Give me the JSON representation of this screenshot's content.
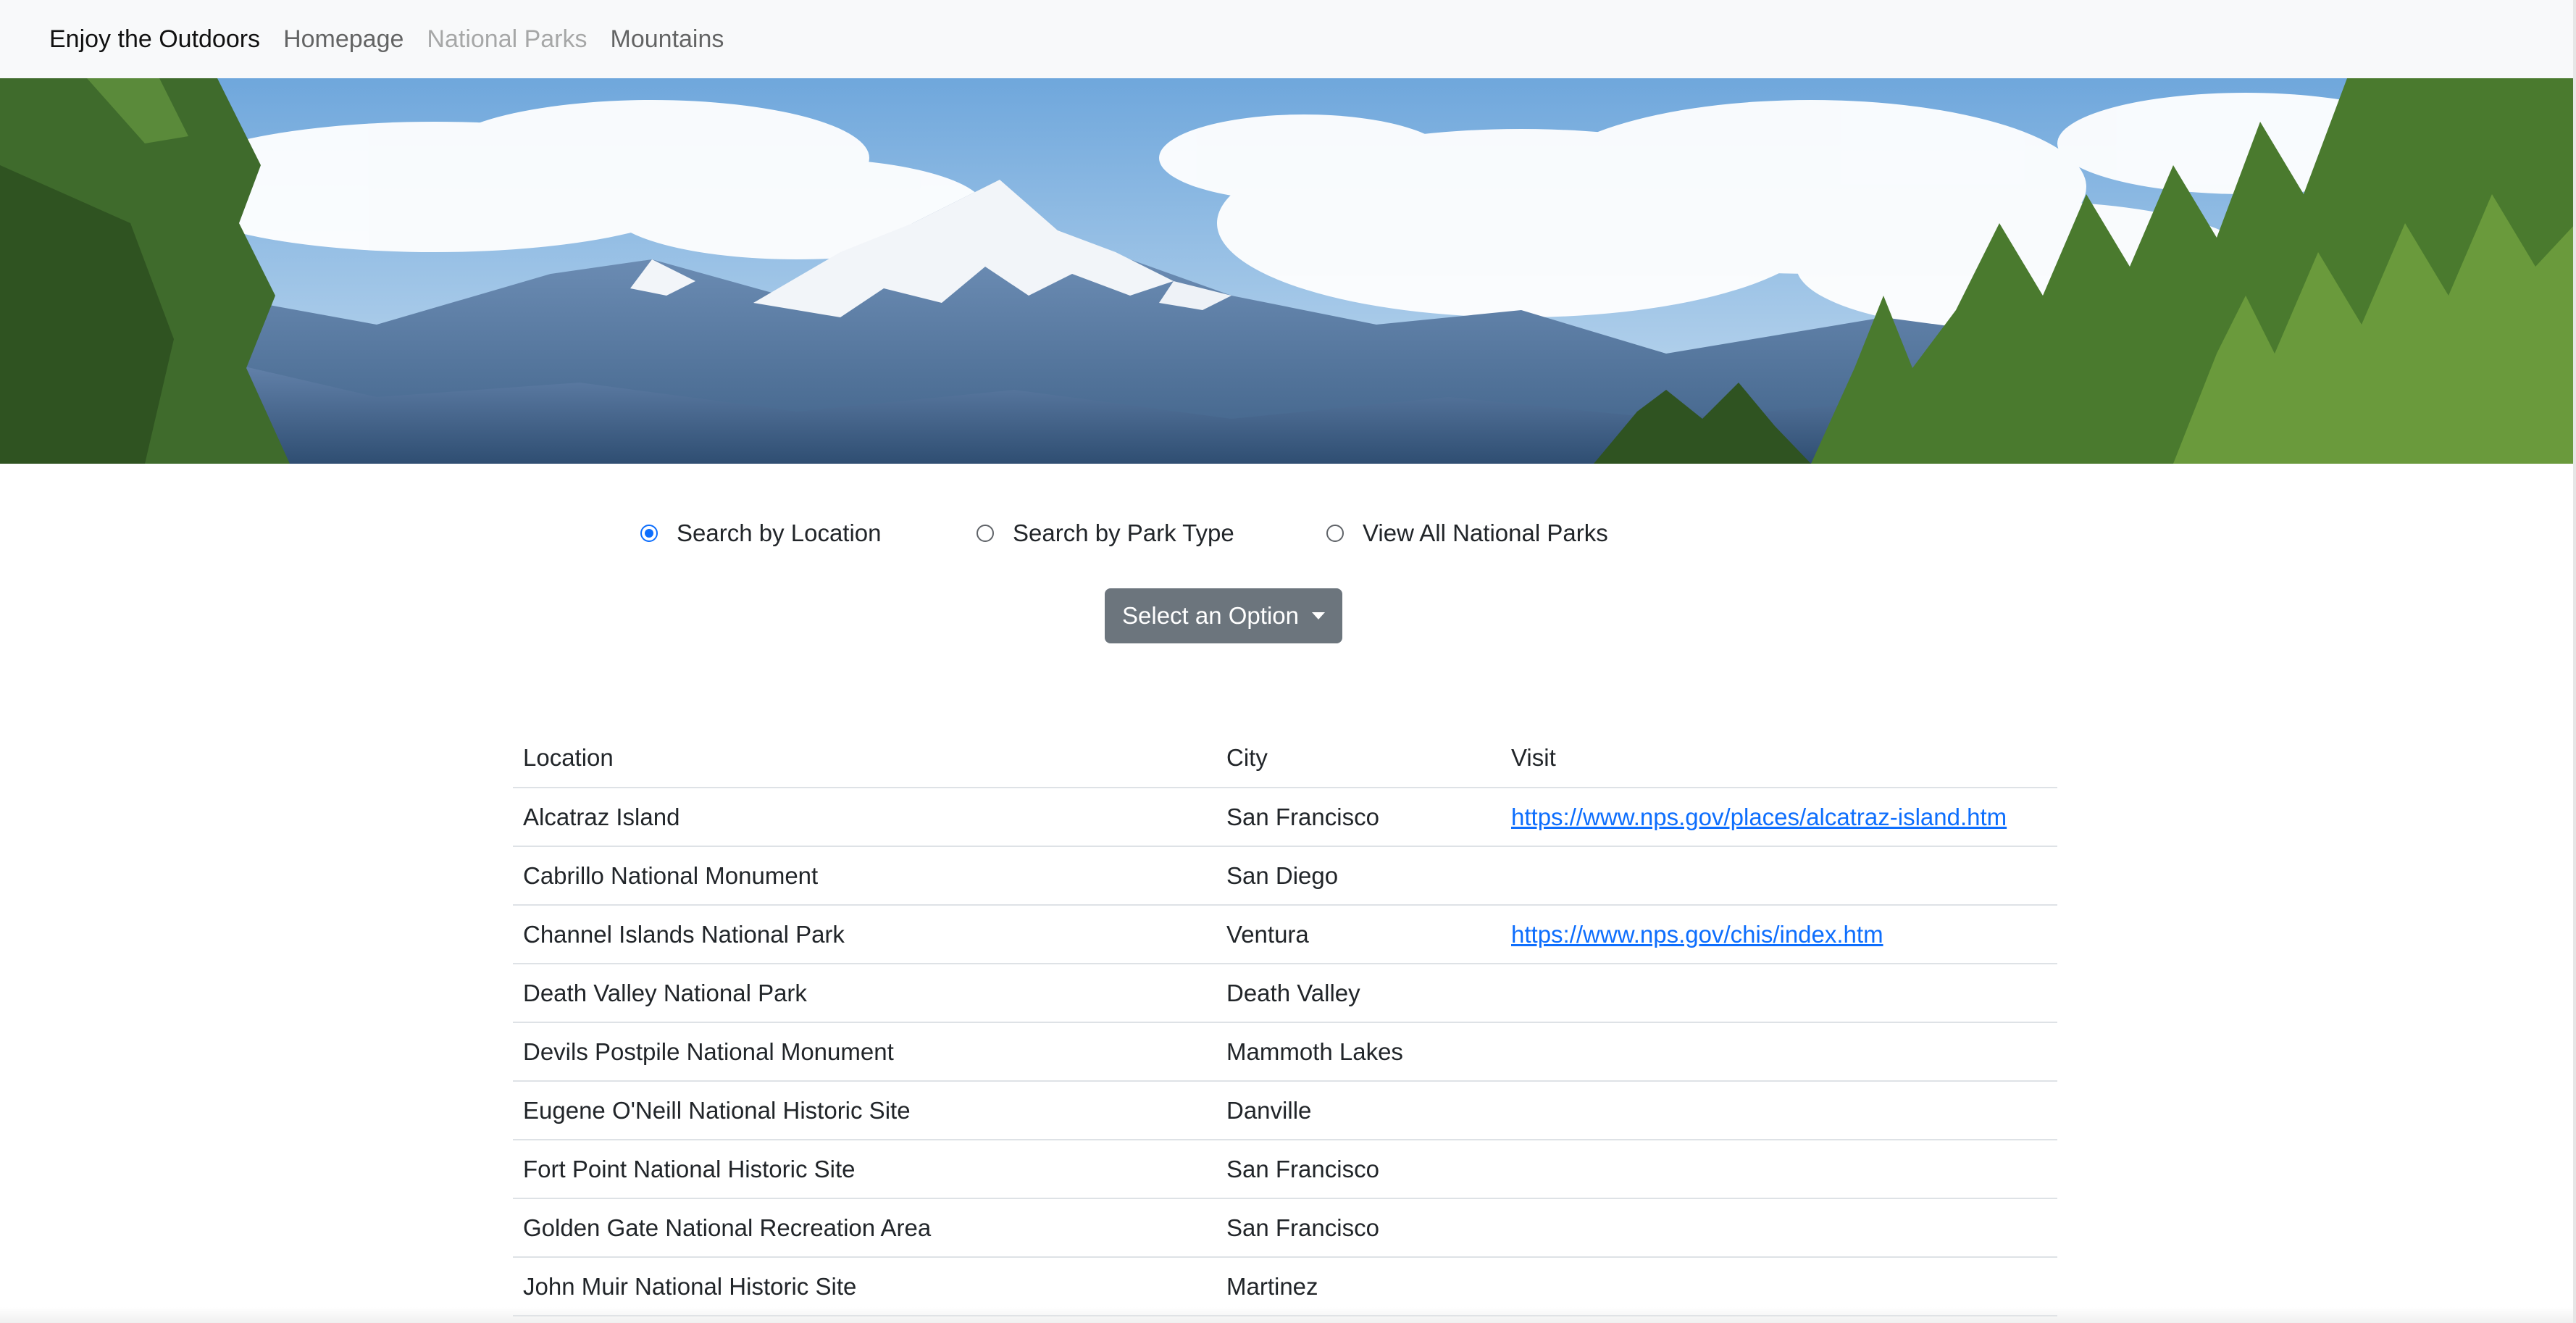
{
  "navbar": {
    "brand": "Enjoy the Outdoors",
    "links": [
      {
        "label": "Homepage",
        "state": "normal"
      },
      {
        "label": "National Parks",
        "state": "disabled"
      },
      {
        "label": "Mountains",
        "state": "normal"
      }
    ]
  },
  "hero": {
    "colors": {
      "sky_top": "#6fa7dc",
      "sky_bottom": "#c8def0",
      "mountain": "#5b7fa8",
      "snow": "#f2f5f9",
      "forest": "#3f6b2c"
    }
  },
  "search": {
    "options": [
      {
        "label": "Search by Location",
        "checked": true
      },
      {
        "label": "Search by Park Type",
        "checked": false
      },
      {
        "label": "View All National Parks",
        "checked": false
      }
    ],
    "dropdown_label": "Select an Option"
  },
  "table": {
    "headers": [
      "Location",
      "City",
      "Visit"
    ],
    "rows": [
      {
        "location": "Alcatraz Island",
        "city": "San Francisco",
        "visit": "https://www.nps.gov/places/alcatraz-island.htm"
      },
      {
        "location": "Cabrillo National Monument",
        "city": "San Diego",
        "visit": ""
      },
      {
        "location": "Channel Islands National Park",
        "city": "Ventura",
        "visit": "https://www.nps.gov/chis/index.htm"
      },
      {
        "location": "Death Valley National Park",
        "city": "Death Valley",
        "visit": ""
      },
      {
        "location": "Devils Postpile National Monument",
        "city": "Mammoth Lakes",
        "visit": ""
      },
      {
        "location": "Eugene O'Neill National Historic Site",
        "city": "Danville",
        "visit": ""
      },
      {
        "location": "Fort Point National Historic Site",
        "city": "San Francisco",
        "visit": ""
      },
      {
        "location": "Golden Gate National Recreation Area",
        "city": "San Francisco",
        "visit": ""
      },
      {
        "location": "John Muir National Historic Site",
        "city": "Martinez",
        "visit": ""
      }
    ]
  }
}
